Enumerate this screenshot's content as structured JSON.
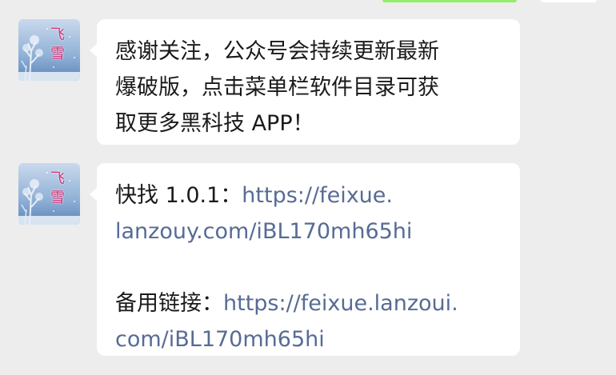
{
  "messages": [
    {
      "sender_avatar": "feixue-snow-avatar",
      "avatar_text": "飞雪",
      "lines": [
        "感谢关注，公众号会持续更新最新",
        "爆破版，点击菜单栏软件目录可获",
        "取更多黑科技 APP！"
      ]
    },
    {
      "sender_avatar": "feixue-snow-avatar",
      "avatar_text": "飞雪",
      "app_label": "快找 1.0.1：",
      "app_link_line1": "https://feixue.",
      "app_link_line2": "lanzouy.com/iBL170mh65hi",
      "backup_label": "备用链接：",
      "backup_link_line1": "https://feixue.lanzoui.",
      "backup_link_line2": "com/iBL170mh65hi"
    }
  ],
  "colors": {
    "background": "#ededed",
    "bubble": "#ffffff",
    "link": "#576b95",
    "text": "#1a1a1a",
    "own_bubble": "#95ec69"
  }
}
